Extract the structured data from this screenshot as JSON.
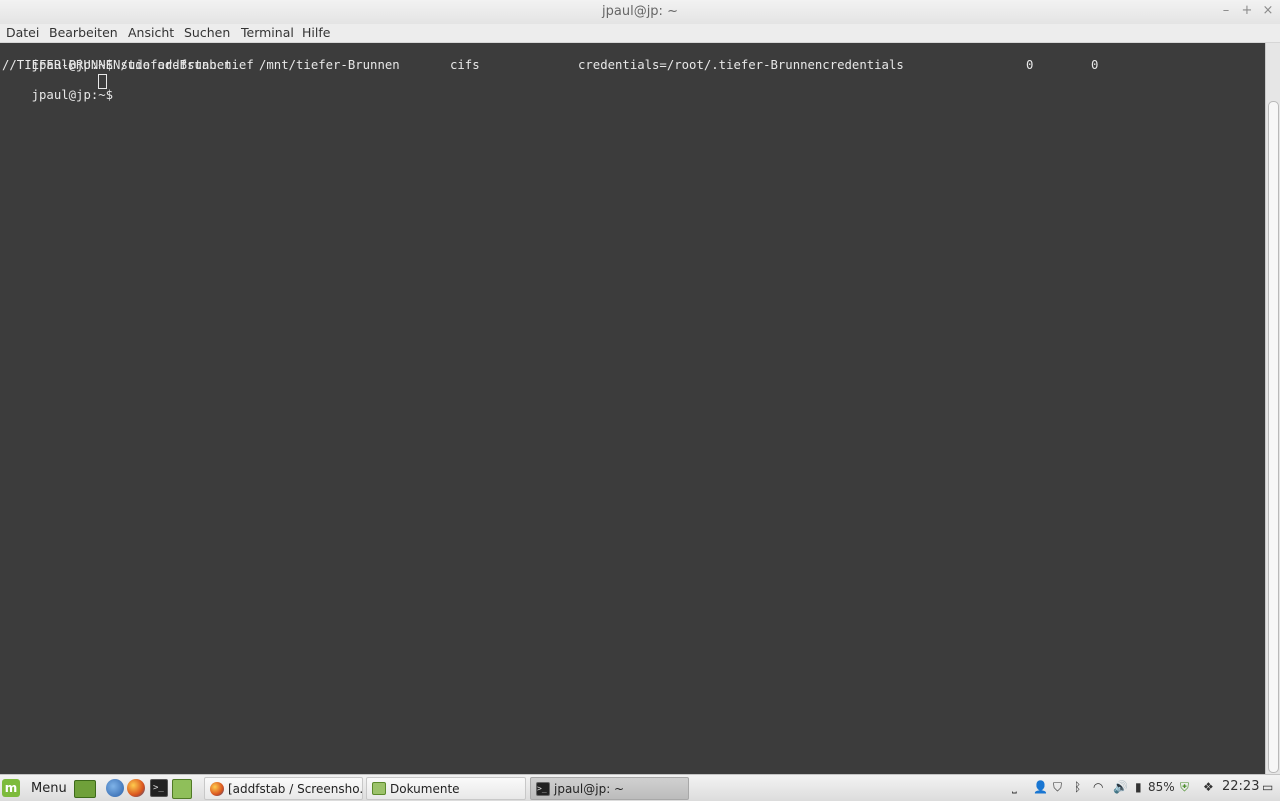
{
  "window": {
    "title": "jpaul@jp: ~",
    "controls": {
      "minimize": "–",
      "maximize": "+",
      "close": "×"
    }
  },
  "menu": {
    "items": [
      "Datei",
      "Bearbeiten",
      "Ansicht",
      "Suchen",
      "Terminal",
      "Hilfe"
    ]
  },
  "terminal": {
    "lines": [
      {
        "prompt": "jpaul@jp:~$ ",
        "command": "sudo addfstab tief"
      },
      {
        "output_fields": [
          "//TIEFER-BRUNNEN/tiefer-Brunnen",
          "/mnt/tiefer-Brunnen",
          "cifs",
          "credentials=/root/.tiefer-Brunnencredentials",
          "0",
          "0"
        ]
      },
      {
        "prompt": "jpaul@jp:~$ ",
        "command": ""
      }
    ]
  },
  "taskbar": {
    "menu_label": "Menu",
    "launchers": [
      "desktop-icon",
      "thunderbird-icon",
      "firefox-icon",
      "terminal-icon",
      "files-icon"
    ],
    "tasks": [
      {
        "label": "[addfstab / Screensho...",
        "icon": "firefox-icon",
        "active": false
      },
      {
        "label": "Dokumente",
        "icon": "folder-icon",
        "active": false
      },
      {
        "label": "jpaul@jp: ~",
        "icon": "terminal-icon",
        "active": true
      }
    ],
    "tray": {
      "battery_percent": "85%",
      "clock": "22:23"
    }
  },
  "colors": {
    "terminal_bg": "#3c3c3c",
    "terminal_fg": "#e8e8e8",
    "accent_mint": "#7dbb3c"
  }
}
